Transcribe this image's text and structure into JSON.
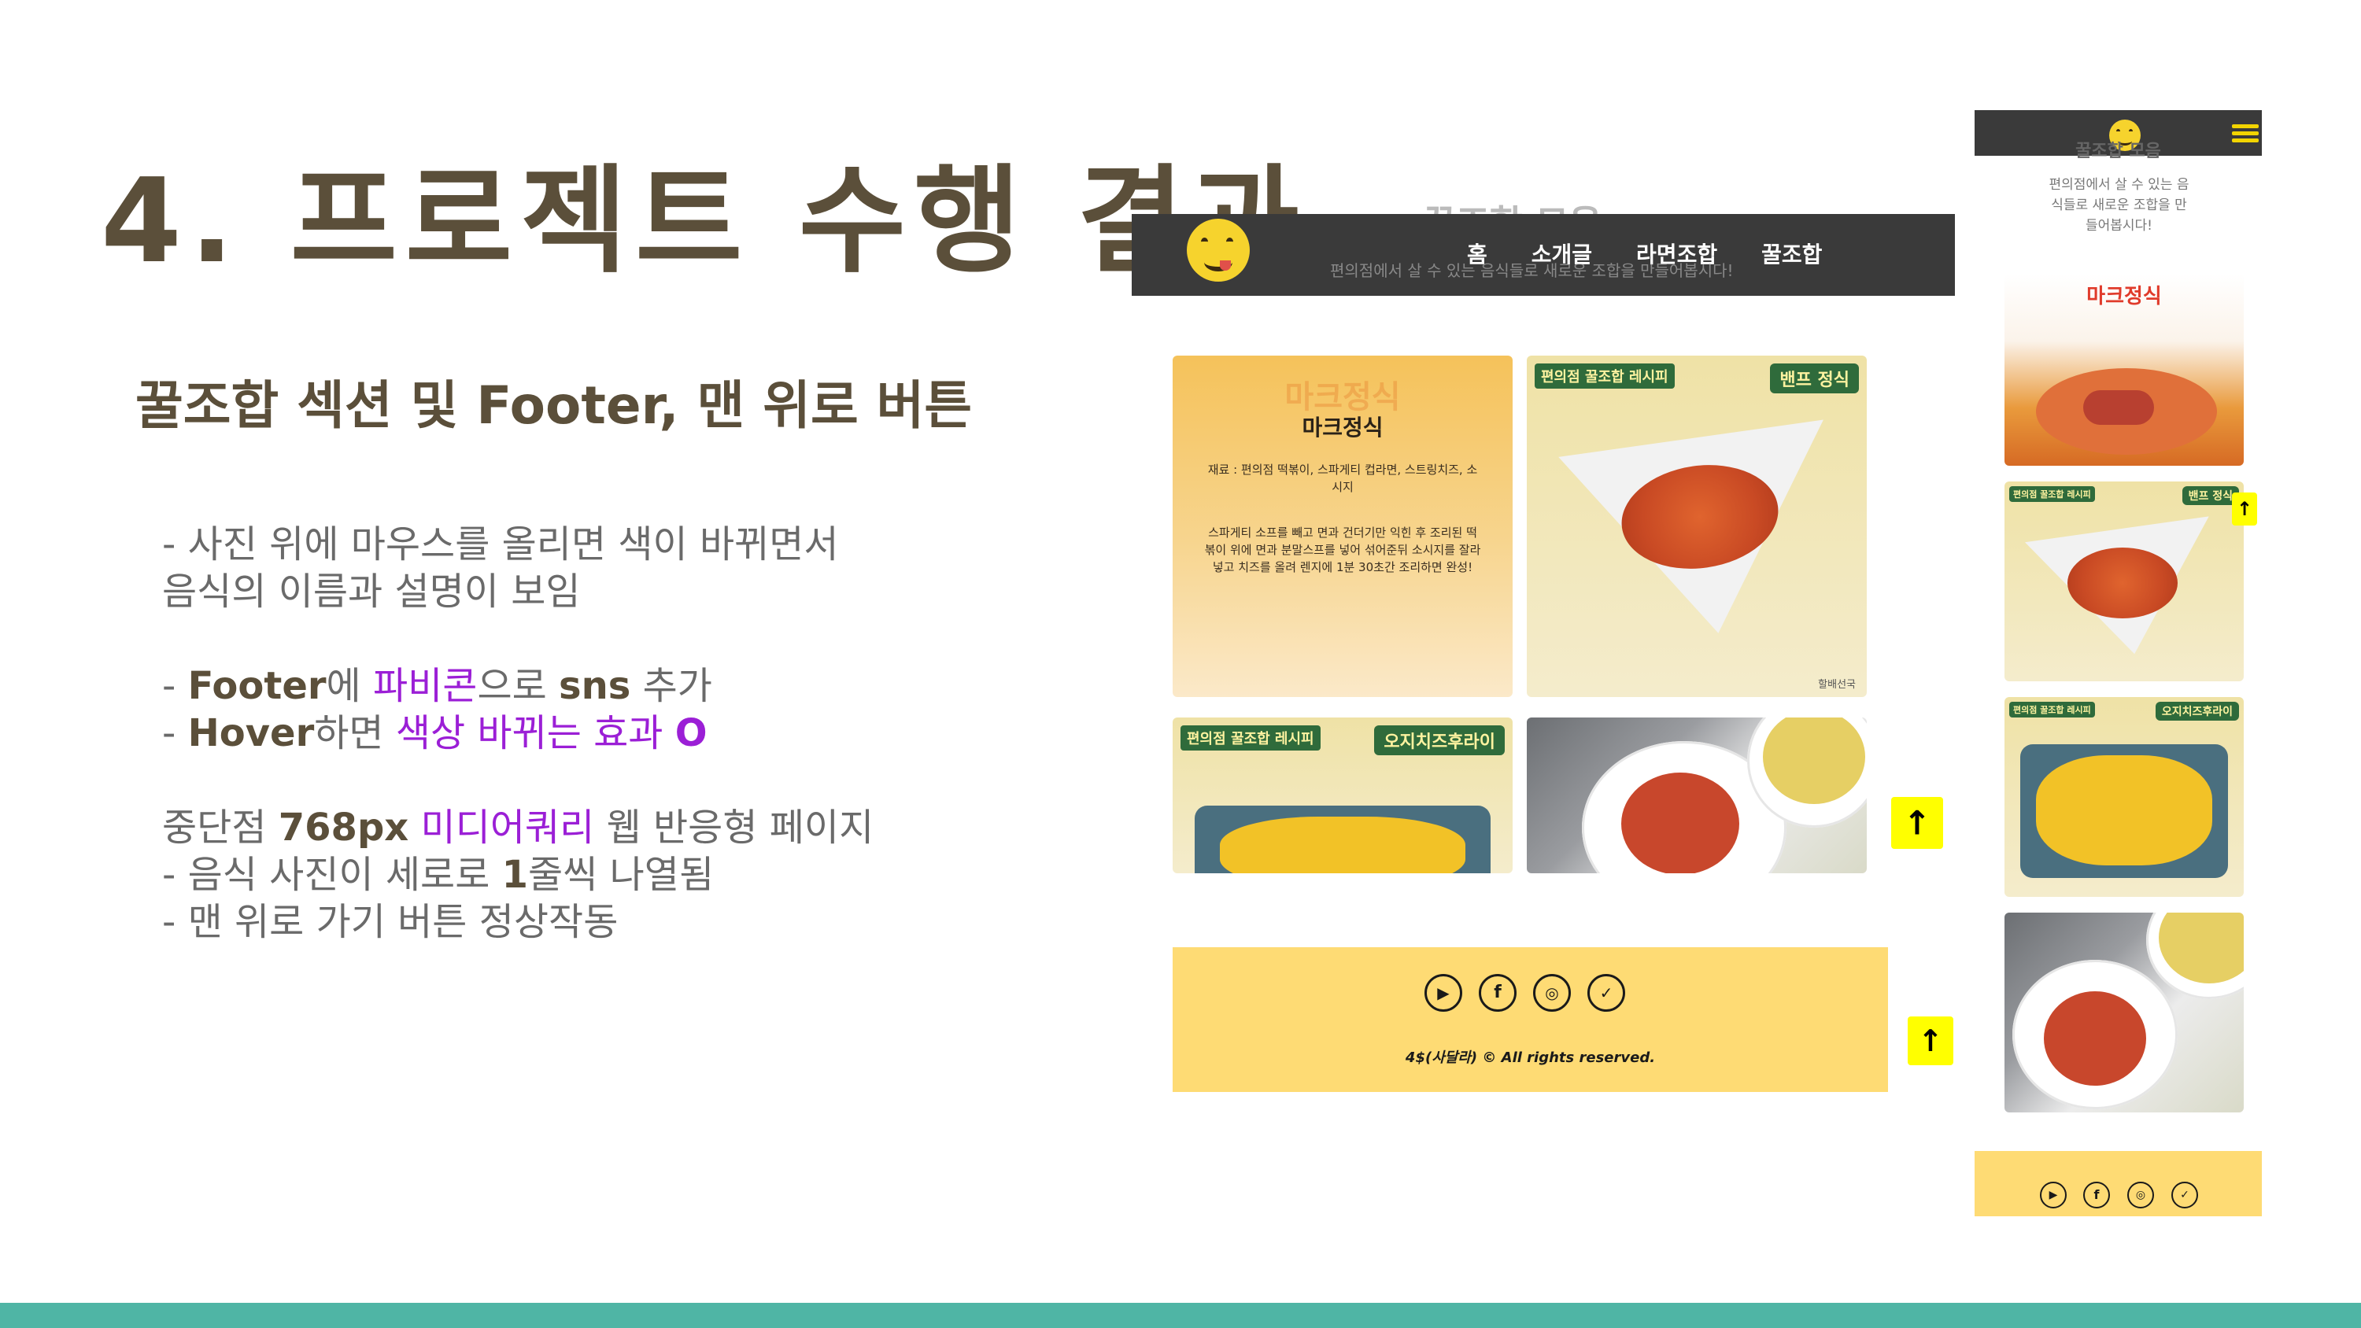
{
  "slide": {
    "title": "4. 프로젝트 수행 결과",
    "subtitle": "꿀조합 섹션 및 Footer, 맨 위로 버튼",
    "desc": {
      "line1": "- 사진 위에 마우스를 올리면 색이 바뀌면서",
      "line2": "음식의 이름과 설명이 보임",
      "footer_line": {
        "p1": "- ",
        "b1": "Footer",
        "p2": "에 ",
        "hl": "파비콘",
        "p3": "으로 ",
        "b2": "sns",
        "p4": " 추가"
      },
      "hover_line": {
        "p1": "- ",
        "b1": "Hover",
        "p2": "하면 ",
        "hl": "색상 바뀌는 효과",
        "p3": " ",
        "hlb": "O"
      },
      "media_line": {
        "p1": "중단점 ",
        "b1": "768px",
        "p2": " ",
        "hl": "미디어쿼리",
        "p3": " 웹 반응형 페이지"
      },
      "photo_line": {
        "p1": "- 음식 사진이 세로로 ",
        "b1": "1",
        "p2": "줄씩 나열됨"
      },
      "button_line": "- 맨 위로 가기 버튼 정상작동"
    },
    "accent_color": "#9b1fd6",
    "bar_color": "#4fb5a5"
  },
  "desktop": {
    "nav": [
      "홈",
      "소개글",
      "라면조합",
      "꿀조합"
    ],
    "ghost_title": "꿀조합 모음",
    "ghost_desc": "편의점에서 살 수 있는 음식들로 새로운 조합을 만들어봅시다!",
    "cards": {
      "mark": {
        "ghost": "마크정식",
        "name": "마크정식",
        "desc": "재료 : 편의점 떡볶이, 스파게티 컵라면, 스트링치즈, 소시지",
        "recipe": "스파게티 소프를 빼고 면과 건더기만 익힌 후 조리된 떡볶이 위에 면과 분말스프를 넣어 섞어준뒤 소시지를 잘라 넣고 치즈를 올려 렌지에 1분 30초간 조리하면 완성!"
      },
      "benf": {
        "badge": "편의점 꿀조합 레시피",
        "name": "밴프 정식",
        "credit": "할배선국"
      },
      "origi": {
        "badge": "편의점 꿀조합 레시피",
        "name": "오지치즈후라이"
      }
    },
    "top_icon": "arrow-up-icon",
    "footer": {
      "icons": [
        "youtube-icon",
        "facebook-icon",
        "instagram-icon",
        "twitter-icon"
      ],
      "copyright": "4$(사달라) © All rights reserved."
    }
  },
  "mobile": {
    "ghost_title": "꿀조합 모음",
    "desc": "편의점에서 살 수 있는 음식들로 새로운 조합을 만들어봅시다!",
    "card_names": [
      "마크정식",
      "밴프 정식",
      "오지치즈후라이"
    ],
    "badge": "편의점 꿀조합 레시피"
  }
}
